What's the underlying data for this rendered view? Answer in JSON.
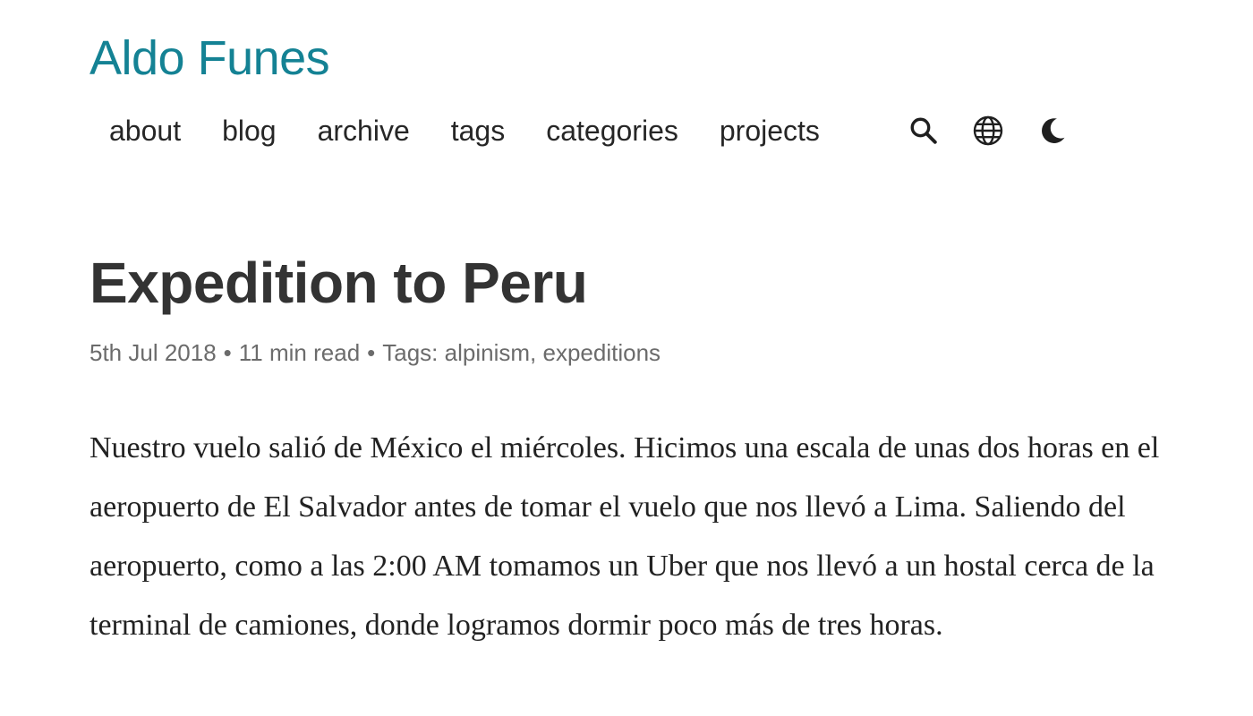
{
  "site": {
    "title": "Aldo Funes"
  },
  "nav": {
    "items": [
      {
        "label": "about"
      },
      {
        "label": "blog"
      },
      {
        "label": "archive"
      },
      {
        "label": "tags"
      },
      {
        "label": "categories"
      },
      {
        "label": "projects"
      }
    ],
    "icons": [
      "search-icon",
      "globe-icon",
      "moon-icon"
    ]
  },
  "post": {
    "title": "Expedition to Peru",
    "date": "5th Jul 2018",
    "separator": "•",
    "read_time": "11 min read",
    "tags_label": "Tags:",
    "tags": [
      "alpinism",
      "expeditions"
    ],
    "tag_separator": ",",
    "body": "Nuestro vuelo salió de México el miércoles. Hicimos una escala de unas dos horas en el aeropuerto de El Salvador antes de tomar el vuelo que nos llevó a Lima. Saliendo del aeropuerto, como a las 2:00 AM tomamos un Uber que nos llevó a un hostal cerca de la terminal de camiones, donde logramos dormir poco más de tres horas."
  },
  "colors": {
    "accent": "#148294",
    "text": "#262626",
    "meta": "#6b6b6b"
  }
}
